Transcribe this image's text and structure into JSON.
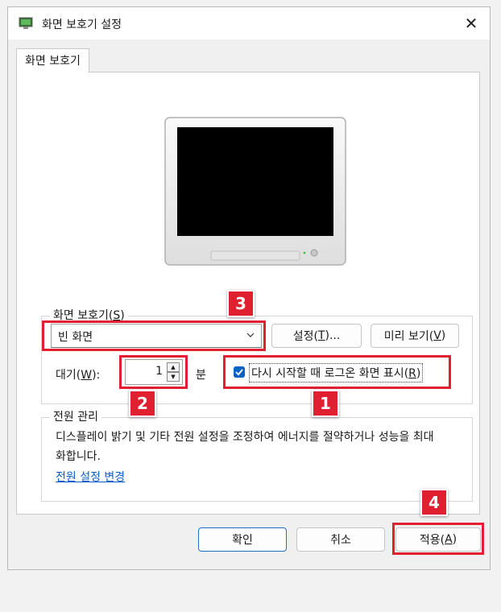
{
  "window": {
    "title": "화면 보호기 설정",
    "close_glyph": "✕"
  },
  "tab": {
    "label": "화면 보호기"
  },
  "screensaver": {
    "group_label_text": "화면 보호기(",
    "group_label_key": "S",
    "group_label_end": ")",
    "selected": "빈 화면",
    "settings_text": "설정(",
    "settings_key": "T",
    "settings_end": ")...",
    "preview_text": "미리 보기(",
    "preview_key": "V",
    "preview_end": ")",
    "wait_text": "대기(",
    "wait_key": "W",
    "wait_end": "):",
    "wait_value": "1",
    "wait_unit": "분",
    "resume_text": "다시 시작할 때 로그온 화면 표시(",
    "resume_key": "R",
    "resume_end": ")",
    "resume_checked": true
  },
  "power": {
    "group_label": "전원 관리",
    "description": "디스플레이 밝기 및 기타 전원 설정을 조정하여 에너지를 절약하거나 성능을 최대화합니다.",
    "link": "전원 설정 변경"
  },
  "footer": {
    "ok": "확인",
    "cancel": "취소",
    "apply_text": "적용(",
    "apply_key": "A",
    "apply_end": ")"
  },
  "annotations": [
    "1",
    "2",
    "3",
    "4"
  ],
  "colors": {
    "accent": "#0a63c4",
    "annotation": "#e02030",
    "link": "#0a5ec8"
  }
}
